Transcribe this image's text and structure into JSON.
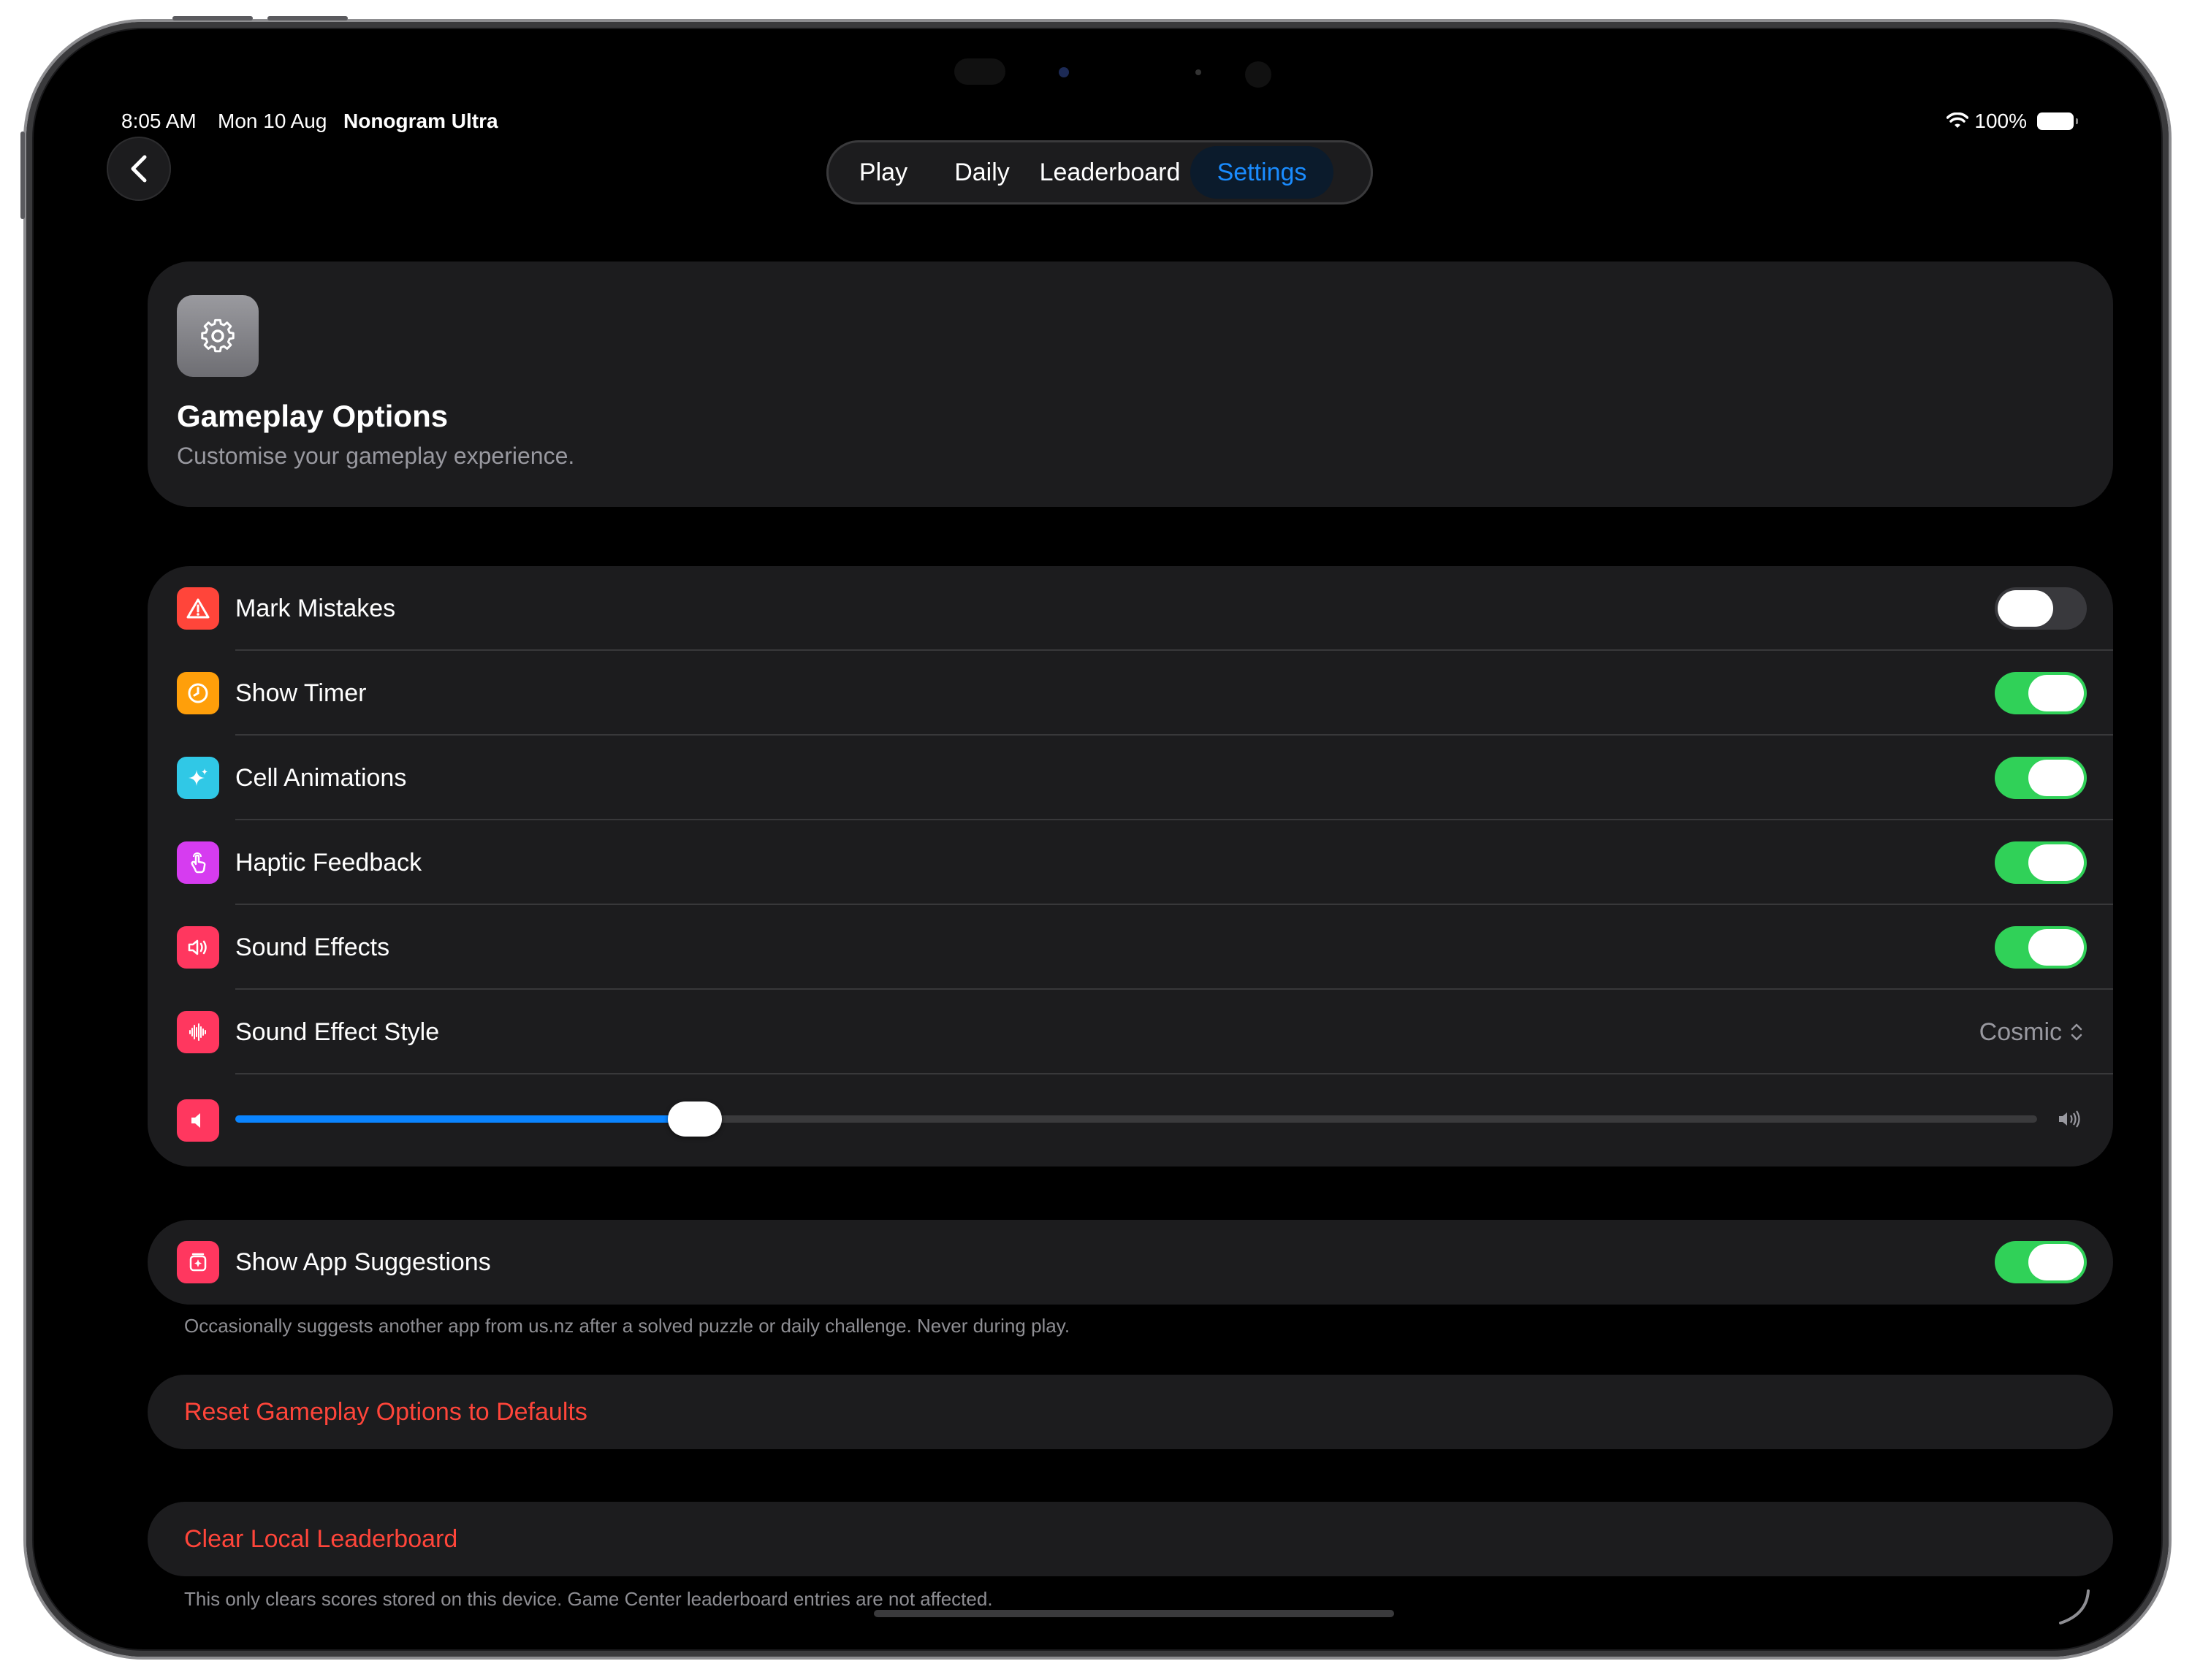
{
  "status_bar": {
    "time": "8:05 AM",
    "date": "Mon 10 Aug",
    "app_name": "Nonogram Ultra",
    "battery": "100%"
  },
  "nav": {
    "tabs": [
      {
        "label": "Play",
        "active": false
      },
      {
        "label": "Daily",
        "active": false
      },
      {
        "label": "Leaderboard",
        "active": false
      },
      {
        "label": "Settings",
        "active": true
      }
    ],
    "accent": "#1a8cff"
  },
  "header_card": {
    "icon": "gear-icon",
    "title": "Gameplay Options",
    "subtitle": "Customise your gameplay experience."
  },
  "gameplay_settings": {
    "rows": [
      {
        "label": "Mark Mistakes",
        "icon": "warning-triangle-icon",
        "icon_color": "#ff453a",
        "type": "toggle",
        "on": false
      },
      {
        "label": "Show Timer",
        "icon": "clock-icon",
        "icon_color": "#ff9f0a",
        "type": "toggle",
        "on": true
      },
      {
        "label": "Cell Animations",
        "icon": "sparkles-icon",
        "icon_color": "#30c8e6",
        "type": "toggle",
        "on": true
      },
      {
        "label": "Haptic Feedback",
        "icon": "hand-tap-icon",
        "icon_color": "#d63cf0",
        "type": "toggle",
        "on": true
      },
      {
        "label": "Sound Effects",
        "icon": "speaker-wave-icon",
        "icon_color": "#ff375f",
        "type": "toggle",
        "on": true
      },
      {
        "label": "Sound Effect Style",
        "icon": "waveform-icon",
        "icon_color": "#ff375f",
        "type": "picker",
        "value": "Cosmic"
      }
    ],
    "volume": {
      "icon": "speaker-icon",
      "icon_color": "#ff375f",
      "level": 0.255
    }
  },
  "suggestions": {
    "label": "Show App Suggestions",
    "icon": "app-gift-icon",
    "icon_color": "#ff375f",
    "on": true,
    "footnote": "Occasionally suggests another app from us.nz after a solved puzzle or daily challenge. Never during play."
  },
  "reset_button": {
    "label": "Reset Gameplay Options to Defaults"
  },
  "clear_button": {
    "label": "Clear Local Leaderboard",
    "footnote": "This only clears scores stored on this device. Game Center leaderboard entries are not affected."
  },
  "colors": {
    "toggle_on": "#30d158",
    "destructive": "#ff453a",
    "card_bg": "#1c1c1e"
  }
}
